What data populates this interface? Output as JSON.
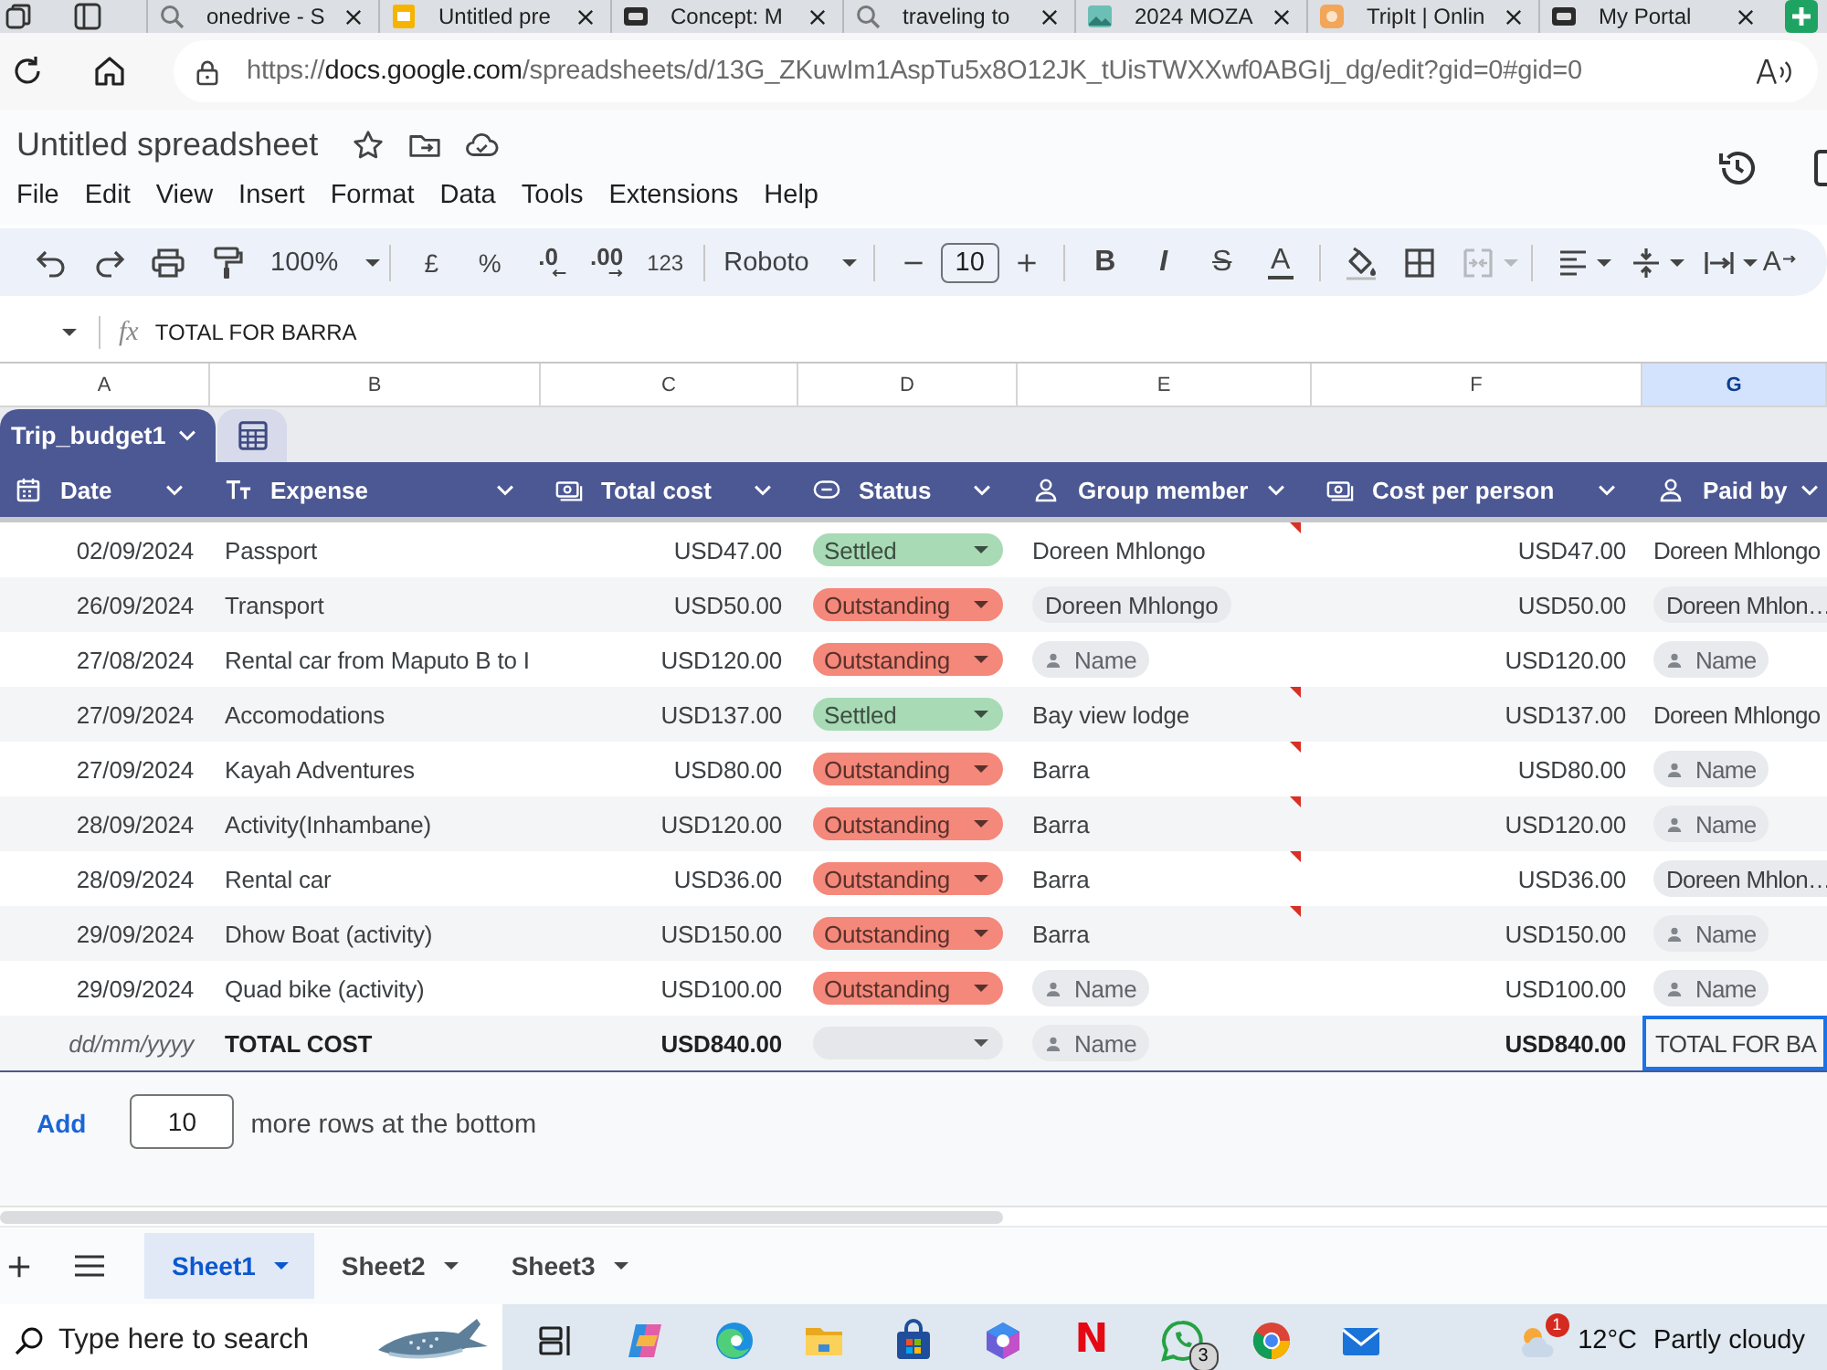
{
  "browser": {
    "tabs": [
      {
        "kind": "search",
        "title": "onedrive - S"
      },
      {
        "kind": "sheets",
        "title": "Untitled pre"
      },
      {
        "kind": "logo",
        "title": "Concept: M"
      },
      {
        "kind": "search",
        "title": "traveling to"
      },
      {
        "kind": "image",
        "title": "2024 MOZA"
      },
      {
        "kind": "travel",
        "title": "TripIt | Onlin"
      },
      {
        "kind": "logo",
        "title": "My Portal"
      }
    ],
    "url": {
      "scheme": "https://",
      "host": "docs.google.com",
      "path": "/spreadsheets/d/13G_ZKuwIm1AspTu5x8O12JK_tUisTWXXwf0ABGIj_dg/edit?gid=0#gid=0"
    }
  },
  "docs": {
    "title": "Untitled spreadsheet",
    "menu": [
      "File",
      "Edit",
      "View",
      "Insert",
      "Format",
      "Data",
      "Tools",
      "Extensions",
      "Help"
    ]
  },
  "toolbar": {
    "zoom": "100%",
    "currency": "£",
    "percent": "%",
    "decrease_decimals": ".0",
    "increase_decimals": ".00",
    "number_format": "123",
    "font": "Roboto",
    "font_size": "10",
    "bold": "B",
    "italic": "I",
    "strikethrough": "S",
    "text_color": "A",
    "merge_disabled": true,
    "text_rotation": "A"
  },
  "formula_bar": {
    "function_label": "fx",
    "formula": "TOTAL FOR BARRA"
  },
  "columns": [
    {
      "letter": "A",
      "selected": false
    },
    {
      "letter": "B",
      "selected": false
    },
    {
      "letter": "C",
      "selected": false
    },
    {
      "letter": "D",
      "selected": false
    },
    {
      "letter": "E",
      "selected": false
    },
    {
      "letter": "F",
      "selected": false
    },
    {
      "letter": "G",
      "selected": true
    }
  ],
  "table": {
    "name": "Trip_budget1",
    "fields": [
      {
        "kind": "date",
        "label": "Date"
      },
      {
        "kind": "text",
        "label": "Expense"
      },
      {
        "kind": "money",
        "label": "Total cost"
      },
      {
        "kind": "status",
        "label": "Status"
      },
      {
        "kind": "person",
        "label": "Group member"
      },
      {
        "kind": "money",
        "label": "Cost per person"
      },
      {
        "kind": "person",
        "label": "Paid by"
      }
    ],
    "rows": [
      {
        "kind": "entry",
        "date": {
          "value": "02/09/2024"
        },
        "expense": "Passport",
        "total_cost": "USD47.00",
        "status": {
          "label": "Settled",
          "color": "#a8dab5"
        },
        "group_member": {
          "kind": "text",
          "value": "Doreen Mhlongo",
          "comment": true
        },
        "cost_per_person": "USD47.00",
        "paid_by": {
          "kind": "text",
          "value": "Doreen Mhlongo",
          "selected": false
        }
      },
      {
        "kind": "entry",
        "date": {
          "value": "26/09/2024"
        },
        "expense": "Transport",
        "total_cost": "USD50.00",
        "status": {
          "label": "Outstanding",
          "color": "#f4887a"
        },
        "group_member": {
          "kind": "chip",
          "value": "Doreen Mhlongo",
          "comment": false
        },
        "cost_per_person": "USD50.00",
        "paid_by": {
          "kind": "chip",
          "value": "Doreen Mhlon…",
          "selected": false
        }
      },
      {
        "kind": "entry",
        "date": {
          "value": "27/08/2024"
        },
        "expense": "Rental car from Maputo B to I",
        "total_cost": "USD120.00",
        "status": {
          "label": "Outstanding",
          "color": "#f4887a"
        },
        "group_member": {
          "kind": "empty",
          "placeholder": "Name",
          "comment": false
        },
        "cost_per_person": "USD120.00",
        "paid_by": {
          "kind": "empty",
          "placeholder": "Name",
          "selected": false
        }
      },
      {
        "kind": "entry",
        "date": {
          "value": "27/09/2024"
        },
        "expense": "Accomodations",
        "total_cost": "USD137.00",
        "status": {
          "label": "Settled",
          "color": "#a8dab5"
        },
        "group_member": {
          "kind": "text",
          "value": "Bay view lodge",
          "comment": true
        },
        "cost_per_person": "USD137.00",
        "paid_by": {
          "kind": "text",
          "value": "Doreen Mhlongo",
          "selected": false
        }
      },
      {
        "kind": "entry",
        "date": {
          "value": "27/09/2024"
        },
        "expense": "Kayah Adventures",
        "total_cost": "USD80.00",
        "status": {
          "label": "Outstanding",
          "color": "#f4887a"
        },
        "group_member": {
          "kind": "text",
          "value": "Barra",
          "comment": true
        },
        "cost_per_person": "USD80.00",
        "paid_by": {
          "kind": "empty",
          "placeholder": "Name",
          "selected": false
        }
      },
      {
        "kind": "entry",
        "date": {
          "value": "28/09/2024"
        },
        "expense": "Activity(Inhambane)",
        "total_cost": "USD120.00",
        "status": {
          "label": "Outstanding",
          "color": "#f4887a"
        },
        "group_member": {
          "kind": "text",
          "value": "Barra",
          "comment": true
        },
        "cost_per_person": "USD120.00",
        "paid_by": {
          "kind": "empty",
          "placeholder": "Name",
          "selected": false
        }
      },
      {
        "kind": "entry",
        "date": {
          "value": "28/09/2024"
        },
        "expense": "Rental car",
        "total_cost": "USD36.00",
        "status": {
          "label": "Outstanding",
          "color": "#f4887a"
        },
        "group_member": {
          "kind": "text",
          "value": "Barra",
          "comment": true
        },
        "cost_per_person": "USD36.00",
        "paid_by": {
          "kind": "chip",
          "value": "Doreen Mhlon…",
          "selected": false
        }
      },
      {
        "kind": "entry",
        "date": {
          "value": "29/09/2024"
        },
        "expense": "Dhow Boat (activity)",
        "total_cost": "USD150.00",
        "status": {
          "label": "Outstanding",
          "color": "#f4887a"
        },
        "group_member": {
          "kind": "text",
          "value": "Barra",
          "comment": true
        },
        "cost_per_person": "USD150.00",
        "paid_by": {
          "kind": "empty",
          "placeholder": "Name",
          "selected": false
        }
      },
      {
        "kind": "entry",
        "date": {
          "value": "29/09/2024"
        },
        "expense": "Quad bike (activity)",
        "total_cost": "USD100.00",
        "status": {
          "label": "Outstanding",
          "color": "#f4887a"
        },
        "group_member": {
          "kind": "empty",
          "placeholder": "Name",
          "comment": false
        },
        "cost_per_person": "USD100.00",
        "paid_by": {
          "kind": "empty",
          "placeholder": "Name",
          "selected": false
        }
      },
      {
        "kind": "total",
        "date": {
          "placeholder": "dd/mm/yyyy"
        },
        "expense": "TOTAL COST",
        "total_cost": "USD840.00",
        "status": {
          "color": "#e6e7ea"
        },
        "group_member": {
          "kind": "empty",
          "placeholder": "Name",
          "comment": false
        },
        "cost_per_person": "USD840.00",
        "paid_by": {
          "kind": "text",
          "value": "TOTAL FOR BA",
          "selected": true
        }
      }
    ]
  },
  "add_rows": {
    "button": "Add",
    "count": "10",
    "label": "more rows at the bottom"
  },
  "sheets": {
    "tabs": [
      {
        "label": "Sheet1",
        "selected": true
      },
      {
        "label": "Sheet2",
        "selected": false
      },
      {
        "label": "Sheet3",
        "selected": false
      }
    ]
  },
  "taskbar": {
    "search_placeholder": "Type here to search",
    "apps": [
      {
        "kind": "taskview"
      },
      {
        "kind": "copilot"
      },
      {
        "kind": "edge"
      },
      {
        "kind": "explorer"
      },
      {
        "kind": "store"
      },
      {
        "kind": "office"
      },
      {
        "kind": "letter",
        "label": "N"
      },
      {
        "kind": "chat",
        "badge": "3"
      },
      {
        "kind": "chrome"
      },
      {
        "kind": "mail"
      }
    ],
    "weather": {
      "badge": "1",
      "temperature": "12°C",
      "condition": "Partly cloudy"
    }
  }
}
